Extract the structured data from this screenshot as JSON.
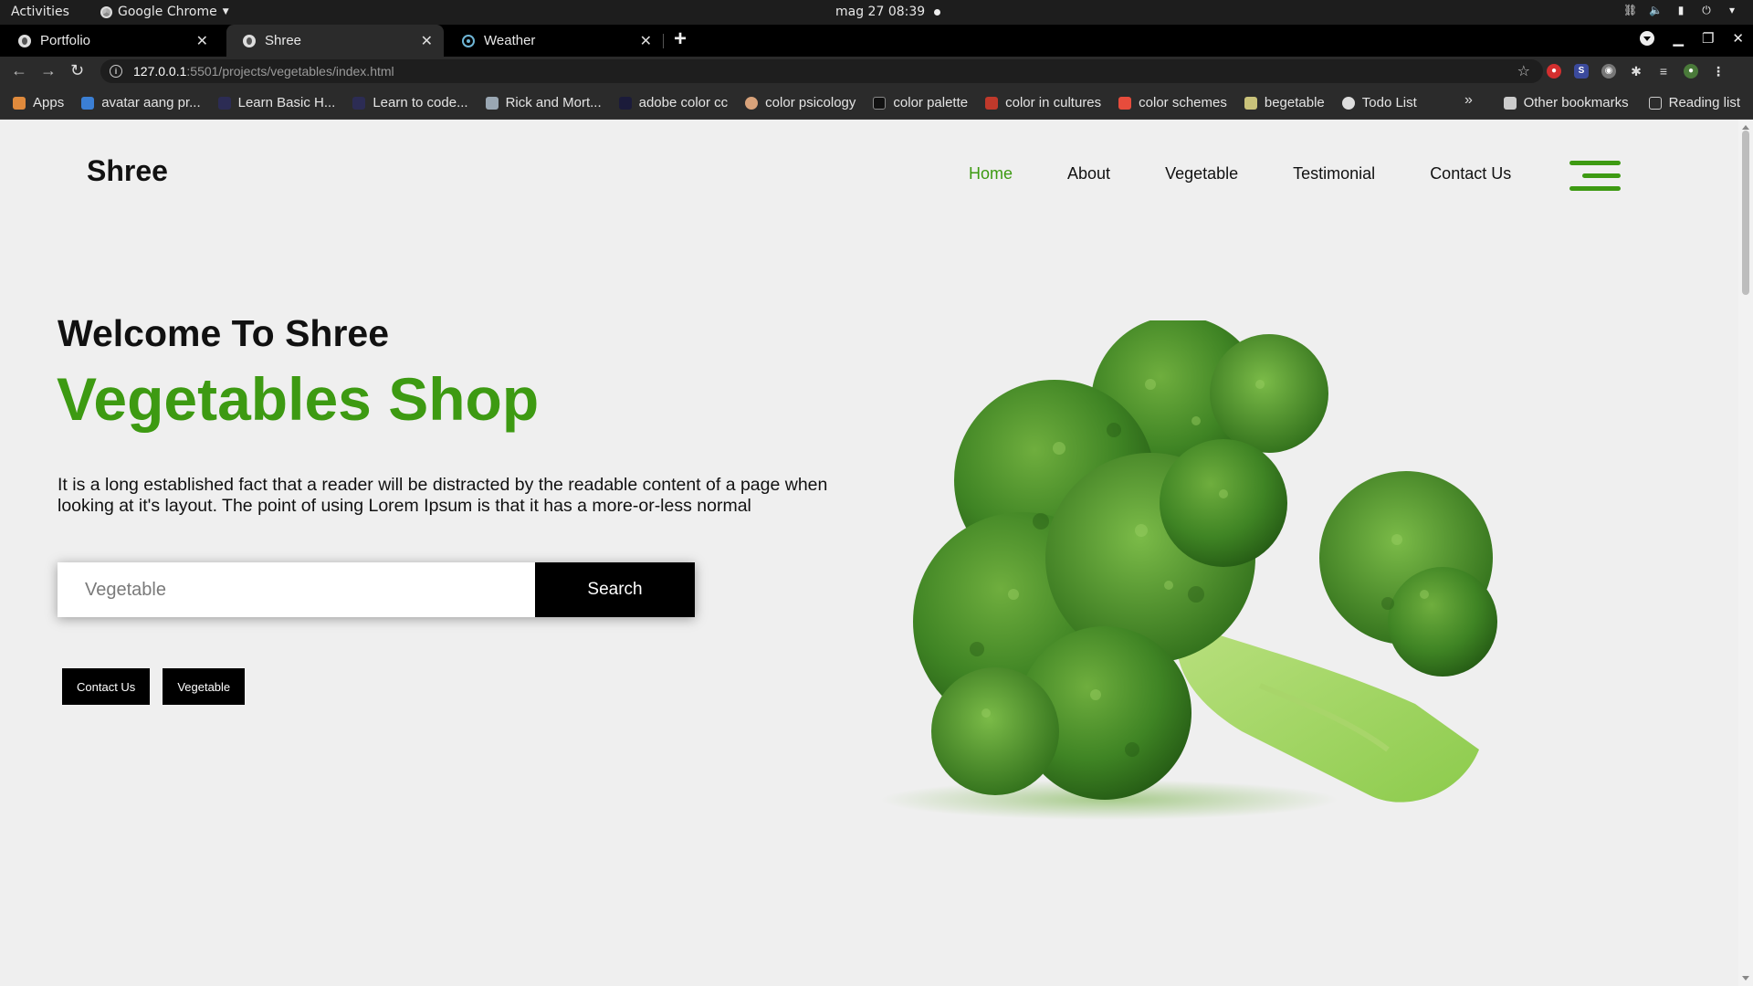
{
  "os": {
    "activities": "Activities",
    "app_name": "Google Chrome",
    "clock": "mag 27  08:39"
  },
  "browser": {
    "tabs": [
      {
        "title": "Portfolio",
        "active": false
      },
      {
        "title": "Shree",
        "active": true
      },
      {
        "title": "Weather",
        "active": false
      }
    ],
    "url_host": "127.0.0.1",
    "url_path": ":5501/projects/vegetables/index.html",
    "bookmarks": [
      {
        "label": "Apps",
        "icon": "apps-grid-icon",
        "color": "#e08a3c"
      },
      {
        "label": "avatar aang pr...",
        "icon": "trello-icon",
        "color": "#3b7fd4"
      },
      {
        "label": "Learn Basic H...",
        "icon": "angular-academy-icon",
        "color": "#2c2c54"
      },
      {
        "label": "Learn to code...",
        "icon": "angular-academy-icon",
        "color": "#2c2c54"
      },
      {
        "label": "Rick and Mort...",
        "icon": "image-icon",
        "color": "#9aa7b3"
      },
      {
        "label": "adobe color cc",
        "icon": "adobe-color-icon",
        "color": "#1b1b3a"
      },
      {
        "label": "color psicology",
        "icon": "face-icon",
        "color": "#d8a27a"
      },
      {
        "label": "color palette",
        "icon": "palette-icon",
        "color": "#111111"
      },
      {
        "label": "color in cultures",
        "icon": "vector-icon",
        "color": "#c0392b"
      },
      {
        "label": "color schemes",
        "icon": "scheme-icon",
        "color": "#e74c3c"
      },
      {
        "label": "begetable",
        "icon": "photo-icon",
        "color": "#c9c27a"
      },
      {
        "label": "Todo List",
        "icon": "globe-icon",
        "color": "#dddddd"
      }
    ],
    "other_bookmarks": "Other bookmarks",
    "reading_list": "Reading list"
  },
  "site": {
    "logo": "Shree",
    "nav": [
      {
        "label": "Home",
        "active": true
      },
      {
        "label": "About",
        "active": false
      },
      {
        "label": "Vegetable",
        "active": false
      },
      {
        "label": "Testimonial",
        "active": false
      },
      {
        "label": "Contact Us",
        "active": false
      }
    ],
    "hero": {
      "subtitle": "Welcome To Shree",
      "title": "Vegetables Shop",
      "text": "It is a long established fact that a reader will be distracted by the readable content of a page when looking at it's layout. The point of using Lorem Ipsum is that it has a more-or-less normal",
      "search_placeholder": "Vegetable",
      "search_button": "Search",
      "buttons": [
        "Contact Us",
        "Vegetable"
      ]
    },
    "colors": {
      "accent": "#3d9a12",
      "background": "#efefef",
      "button": "#000000"
    }
  }
}
